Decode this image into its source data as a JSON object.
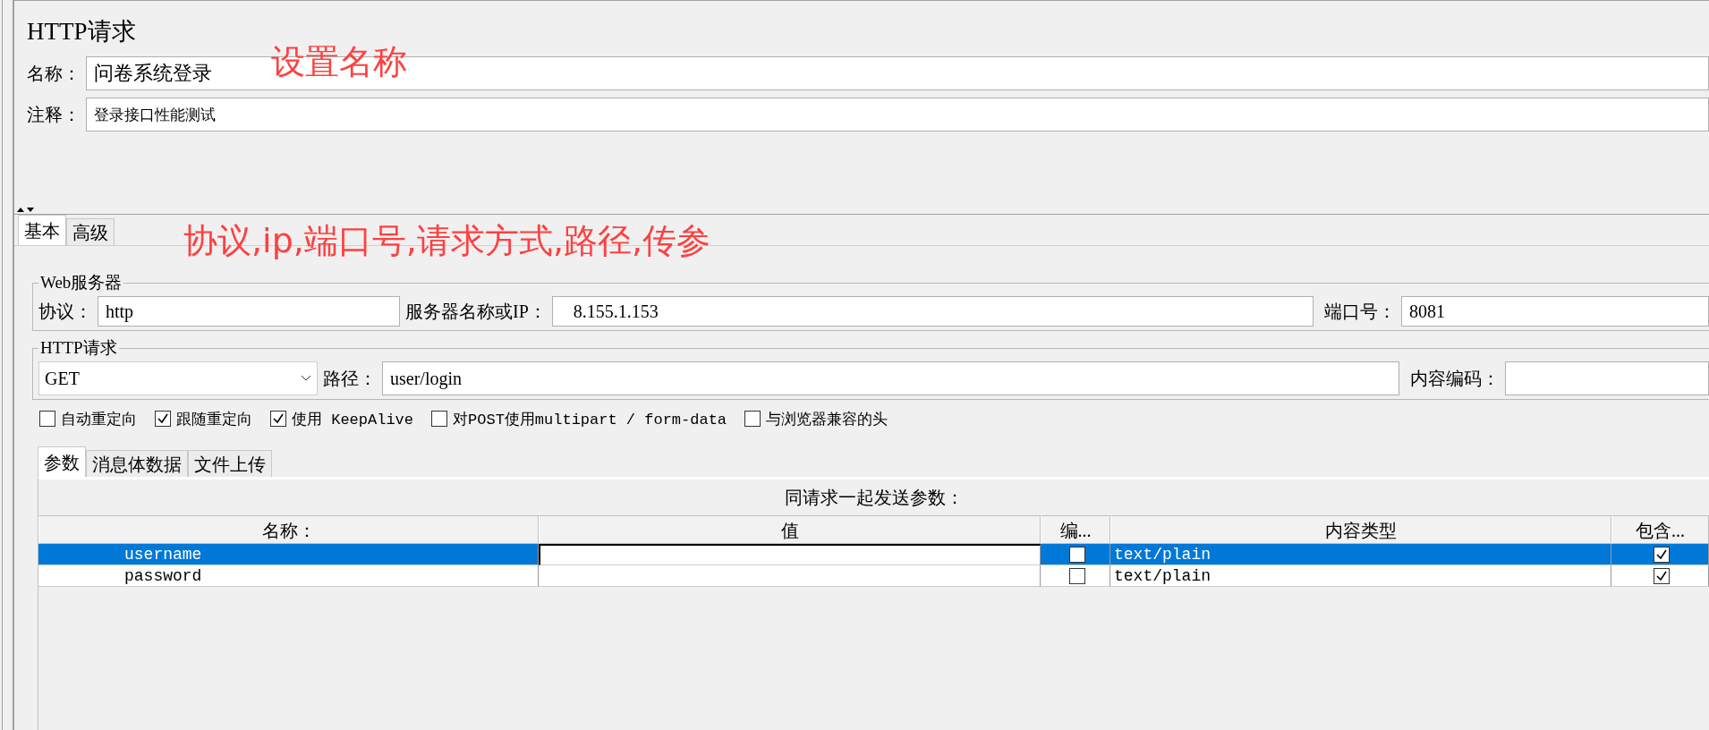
{
  "title": "HTTP请求",
  "name_field": {
    "label": "名称：",
    "value": "问卷系统登录"
  },
  "comment_field": {
    "label": "注释：",
    "value": "登录接口性能测试"
  },
  "annotations": [
    {
      "text": "设置名称",
      "color": "#ff4040"
    },
    {
      "text": "协议,ip,端口号,请求方式,路径,传参",
      "color": "#ff4040"
    }
  ],
  "tabs": [
    {
      "label": "基本",
      "selected": true
    },
    {
      "label": "高级",
      "selected": false
    }
  ],
  "web_server": {
    "legend": "Web服务器",
    "protocol": {
      "label": "协议：",
      "value": "http"
    },
    "server": {
      "label": "服务器名称或IP：",
      "value": "   8.155.1.153"
    },
    "port": {
      "label": "端口号：",
      "value": "8081"
    }
  },
  "http_request": {
    "legend": "HTTP请求",
    "method": "GET",
    "path": {
      "label": "路径：",
      "value": "user/login"
    },
    "encoding": {
      "label": "内容编码："
    }
  },
  "options": [
    {
      "label": "自动重定向",
      "checked": false
    },
    {
      "label": "跟随重定向",
      "checked": true
    },
    {
      "label": "使用 KeepAlive",
      "checked": true
    },
    {
      "label": "对POST使用multipart / form-data",
      "checked": false
    },
    {
      "label": "与浏览器兼容的头",
      "checked": false
    }
  ],
  "sub_tabs": [
    {
      "label": "参数",
      "selected": true
    },
    {
      "label": "消息体数据",
      "selected": false
    },
    {
      "label": "文件上传",
      "selected": false
    }
  ],
  "params_caption": "同请求一起发送参数：",
  "table": {
    "columns": [
      "名称：",
      "值",
      "编...",
      "内容类型",
      "包含..."
    ],
    "rows": [
      {
        "name": "username",
        "encode": false,
        "content_type": "text/plain",
        "include": true,
        "selected": true
      },
      {
        "name": "password",
        "encode": false,
        "content_type": "text/plain",
        "include": true,
        "selected": false
      }
    ]
  }
}
